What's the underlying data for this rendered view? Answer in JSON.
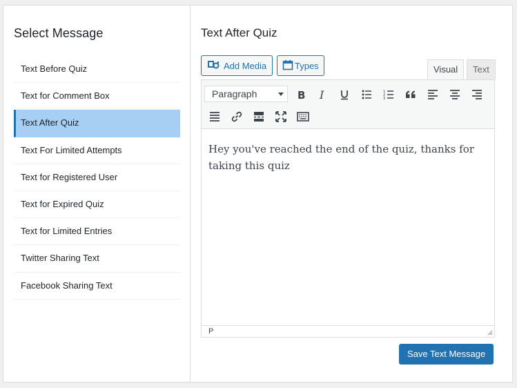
{
  "sidebar": {
    "title": "Select Message",
    "items": [
      {
        "label": "Text Before Quiz",
        "active": false
      },
      {
        "label": "Text for Comment Box",
        "active": false
      },
      {
        "label": "Text After Quiz",
        "active": true
      },
      {
        "label": "Text For Limited Attempts",
        "active": false
      },
      {
        "label": "Text for Registered User",
        "active": false
      },
      {
        "label": "Text for Expired Quiz",
        "active": false
      },
      {
        "label": "Text for Limited Entries",
        "active": false
      },
      {
        "label": "Twitter Sharing Text",
        "active": false
      },
      {
        "label": "Facebook Sharing Text",
        "active": false
      }
    ]
  },
  "main": {
    "title": "Text After Quiz",
    "add_media_label": "Add Media",
    "types_label": "Types",
    "tabs": [
      {
        "label": "Visual",
        "active": true
      },
      {
        "label": "Text",
        "active": false
      }
    ],
    "format_select": "Paragraph",
    "toolbar_icons": [
      "bold-icon",
      "italic-icon",
      "underline-icon",
      "bullet-list-icon",
      "numbered-list-icon",
      "blockquote-icon",
      "align-left-icon",
      "align-center-icon",
      "align-right-icon",
      "justify-icon",
      "link-icon",
      "read-more-icon",
      "fullscreen-icon",
      "keyboard-icon"
    ],
    "content": "Hey you've reached the end of the quiz, thanks for taking this quiz",
    "status_path": "P",
    "save_label": "Save Text Message"
  },
  "colors": {
    "accent": "#2271b1",
    "active_item_bg": "#a6cff3"
  }
}
